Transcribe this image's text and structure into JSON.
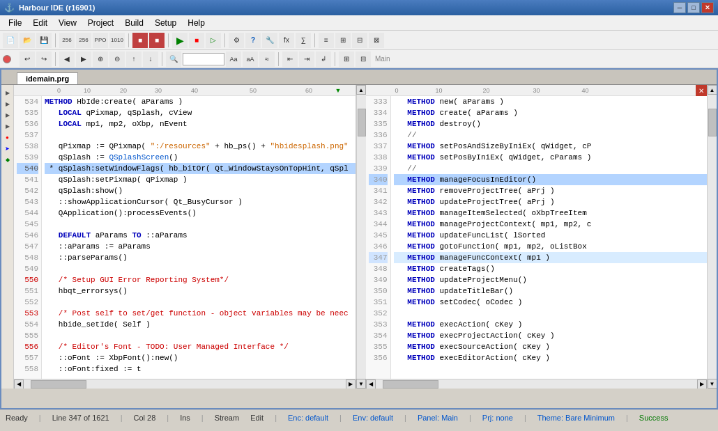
{
  "app": {
    "title": "Harbour IDE (r16901)",
    "icon": "⚓"
  },
  "menubar": {
    "items": [
      "File",
      "Edit",
      "View",
      "Project",
      "Build",
      "Setup",
      "Help"
    ]
  },
  "tabs": {
    "main_label": "Main",
    "file_tab": "idemain.prg"
  },
  "left_editor": {
    "lines": [
      {
        "num": "534",
        "text": "METHOD HbIde:create( aParams )",
        "highlight": false,
        "klass": "normal"
      },
      {
        "num": "535",
        "text": "   LOCAL qPixmap, qSplash, cView",
        "highlight": false
      },
      {
        "num": "536",
        "text": "   LOCAL mp1, mp2, oXbp, nEvent",
        "highlight": false
      },
      {
        "num": "537",
        "text": "",
        "highlight": false
      },
      {
        "num": "538",
        "text": "   qPixmap := QPixmap( \":/resources\" + hb_ps() + \"hbidesplash.png\"",
        "highlight": false
      },
      {
        "num": "539",
        "text": "   qSplash := QSplashScreen()",
        "highlight": false
      },
      {
        "num": "540",
        "text": " * qSplash:setWindowFlags( hb_bitOr( Qt_WindowStaysOnTopHint, qSpl",
        "highlight": true
      },
      {
        "num": "541",
        "text": "   qSplash:setPixmap( qPixmap )",
        "highlight": false
      },
      {
        "num": "542",
        "text": "   qSplash:show()",
        "highlight": false
      },
      {
        "num": "543",
        "text": "   ::showApplicationCursor( Qt_BusyCursor )",
        "highlight": false
      },
      {
        "num": "544",
        "text": "   QApplication():processEvents()",
        "highlight": false
      },
      {
        "num": "545",
        "text": "",
        "highlight": false
      },
      {
        "num": "546",
        "text": "   DEFAULT aParams TO ::aParams",
        "highlight": false
      },
      {
        "num": "547",
        "text": "   ::aParams := aParams",
        "highlight": false
      },
      {
        "num": "548",
        "text": "   ::parseParams()",
        "highlight": false
      },
      {
        "num": "549",
        "text": "",
        "highlight": false
      },
      {
        "num": "550",
        "text": "   /* Setup GUI Error Reporting System*/",
        "highlight": false,
        "comment": true
      },
      {
        "num": "551",
        "text": "   hbqt_errorsys()",
        "highlight": false
      },
      {
        "num": "552",
        "text": "",
        "highlight": false
      },
      {
        "num": "553",
        "text": "   /* Post self to set/get function - object variables may be neec",
        "highlight": false,
        "comment": true
      },
      {
        "num": "554",
        "text": "   hbide_setIde( Self )",
        "highlight": false
      },
      {
        "num": "555",
        "text": "",
        "highlight": false
      },
      {
        "num": "556",
        "text": "   /* Editor's Font - TODO: User Managed Interface */",
        "highlight": false,
        "comment": true
      },
      {
        "num": "557",
        "text": "   ::oFont := XbpFont():new()",
        "highlight": false
      },
      {
        "num": "558",
        "text": "   ::oFont:fixed := t",
        "highlight": false
      }
    ],
    "ruler_marks": [
      "0",
      "10",
      "20",
      "30",
      "40",
      "50",
      "60"
    ]
  },
  "right_editor": {
    "lines": [
      {
        "num": "333",
        "text": "   METHOD new( aParams )"
      },
      {
        "num": "334",
        "text": "   METHOD create( aParams )"
      },
      {
        "num": "335",
        "text": "   METHOD destroy()"
      },
      {
        "num": "336",
        "text": "   //"
      },
      {
        "num": "337",
        "text": "   METHOD setPosAndSizeByIniEx( qWidget, cP"
      },
      {
        "num": "338",
        "text": "   METHOD setPosByIniEx( qWidget, cParams )"
      },
      {
        "num": "339",
        "text": "   //"
      },
      {
        "num": "340",
        "text": "   METHOD manageFocusInEditor()",
        "highlight": true
      },
      {
        "num": "341",
        "text": "   METHOD removeProjectTree( aPrj )"
      },
      {
        "num": "342",
        "text": "   METHOD updateProjectTree( aPrj )"
      },
      {
        "num": "343",
        "text": "   METHOD manageItemSelected( oXbpTreeItem"
      },
      {
        "num": "344",
        "text": "   METHOD manageProjectContext( mp1, mp2, c"
      },
      {
        "num": "345",
        "text": "   METHOD updateFuncList( lSorted"
      },
      {
        "num": "346",
        "text": "   METHOD gotoFunction( mp1, mp2, oListBox"
      },
      {
        "num": "347",
        "text": "   METHOD manageFuncContext( mp1 )",
        "highlight2": true
      },
      {
        "num": "348",
        "text": "   METHOD createTags()"
      },
      {
        "num": "349",
        "text": "   METHOD updateProjectMenu()"
      },
      {
        "num": "350",
        "text": "   METHOD updateTitleBar()"
      },
      {
        "num": "351",
        "text": "   METHOD setCodec( oCodec )"
      },
      {
        "num": "352",
        "text": ""
      },
      {
        "num": "353",
        "text": "   METHOD execAction( cKey )"
      },
      {
        "num": "354",
        "text": "   METHOD execProjectAction( cKey )"
      },
      {
        "num": "355",
        "text": "   METHOD execSourceAction( cKey )"
      },
      {
        "num": "356",
        "text": "   METHOD execEditorAction( cKey )"
      }
    ]
  },
  "statusbar": {
    "ready": "Ready",
    "line_info": "Line 347 of 1621",
    "col_info": "Col 28",
    "mode": "Ins",
    "stream": "Stream",
    "edit": "Edit",
    "enc": "Enc: default",
    "env": "Env: default",
    "panel": "Panel: Main",
    "prj": "Prj: none",
    "theme": "Theme: Bare Minimum",
    "success": "Success"
  }
}
